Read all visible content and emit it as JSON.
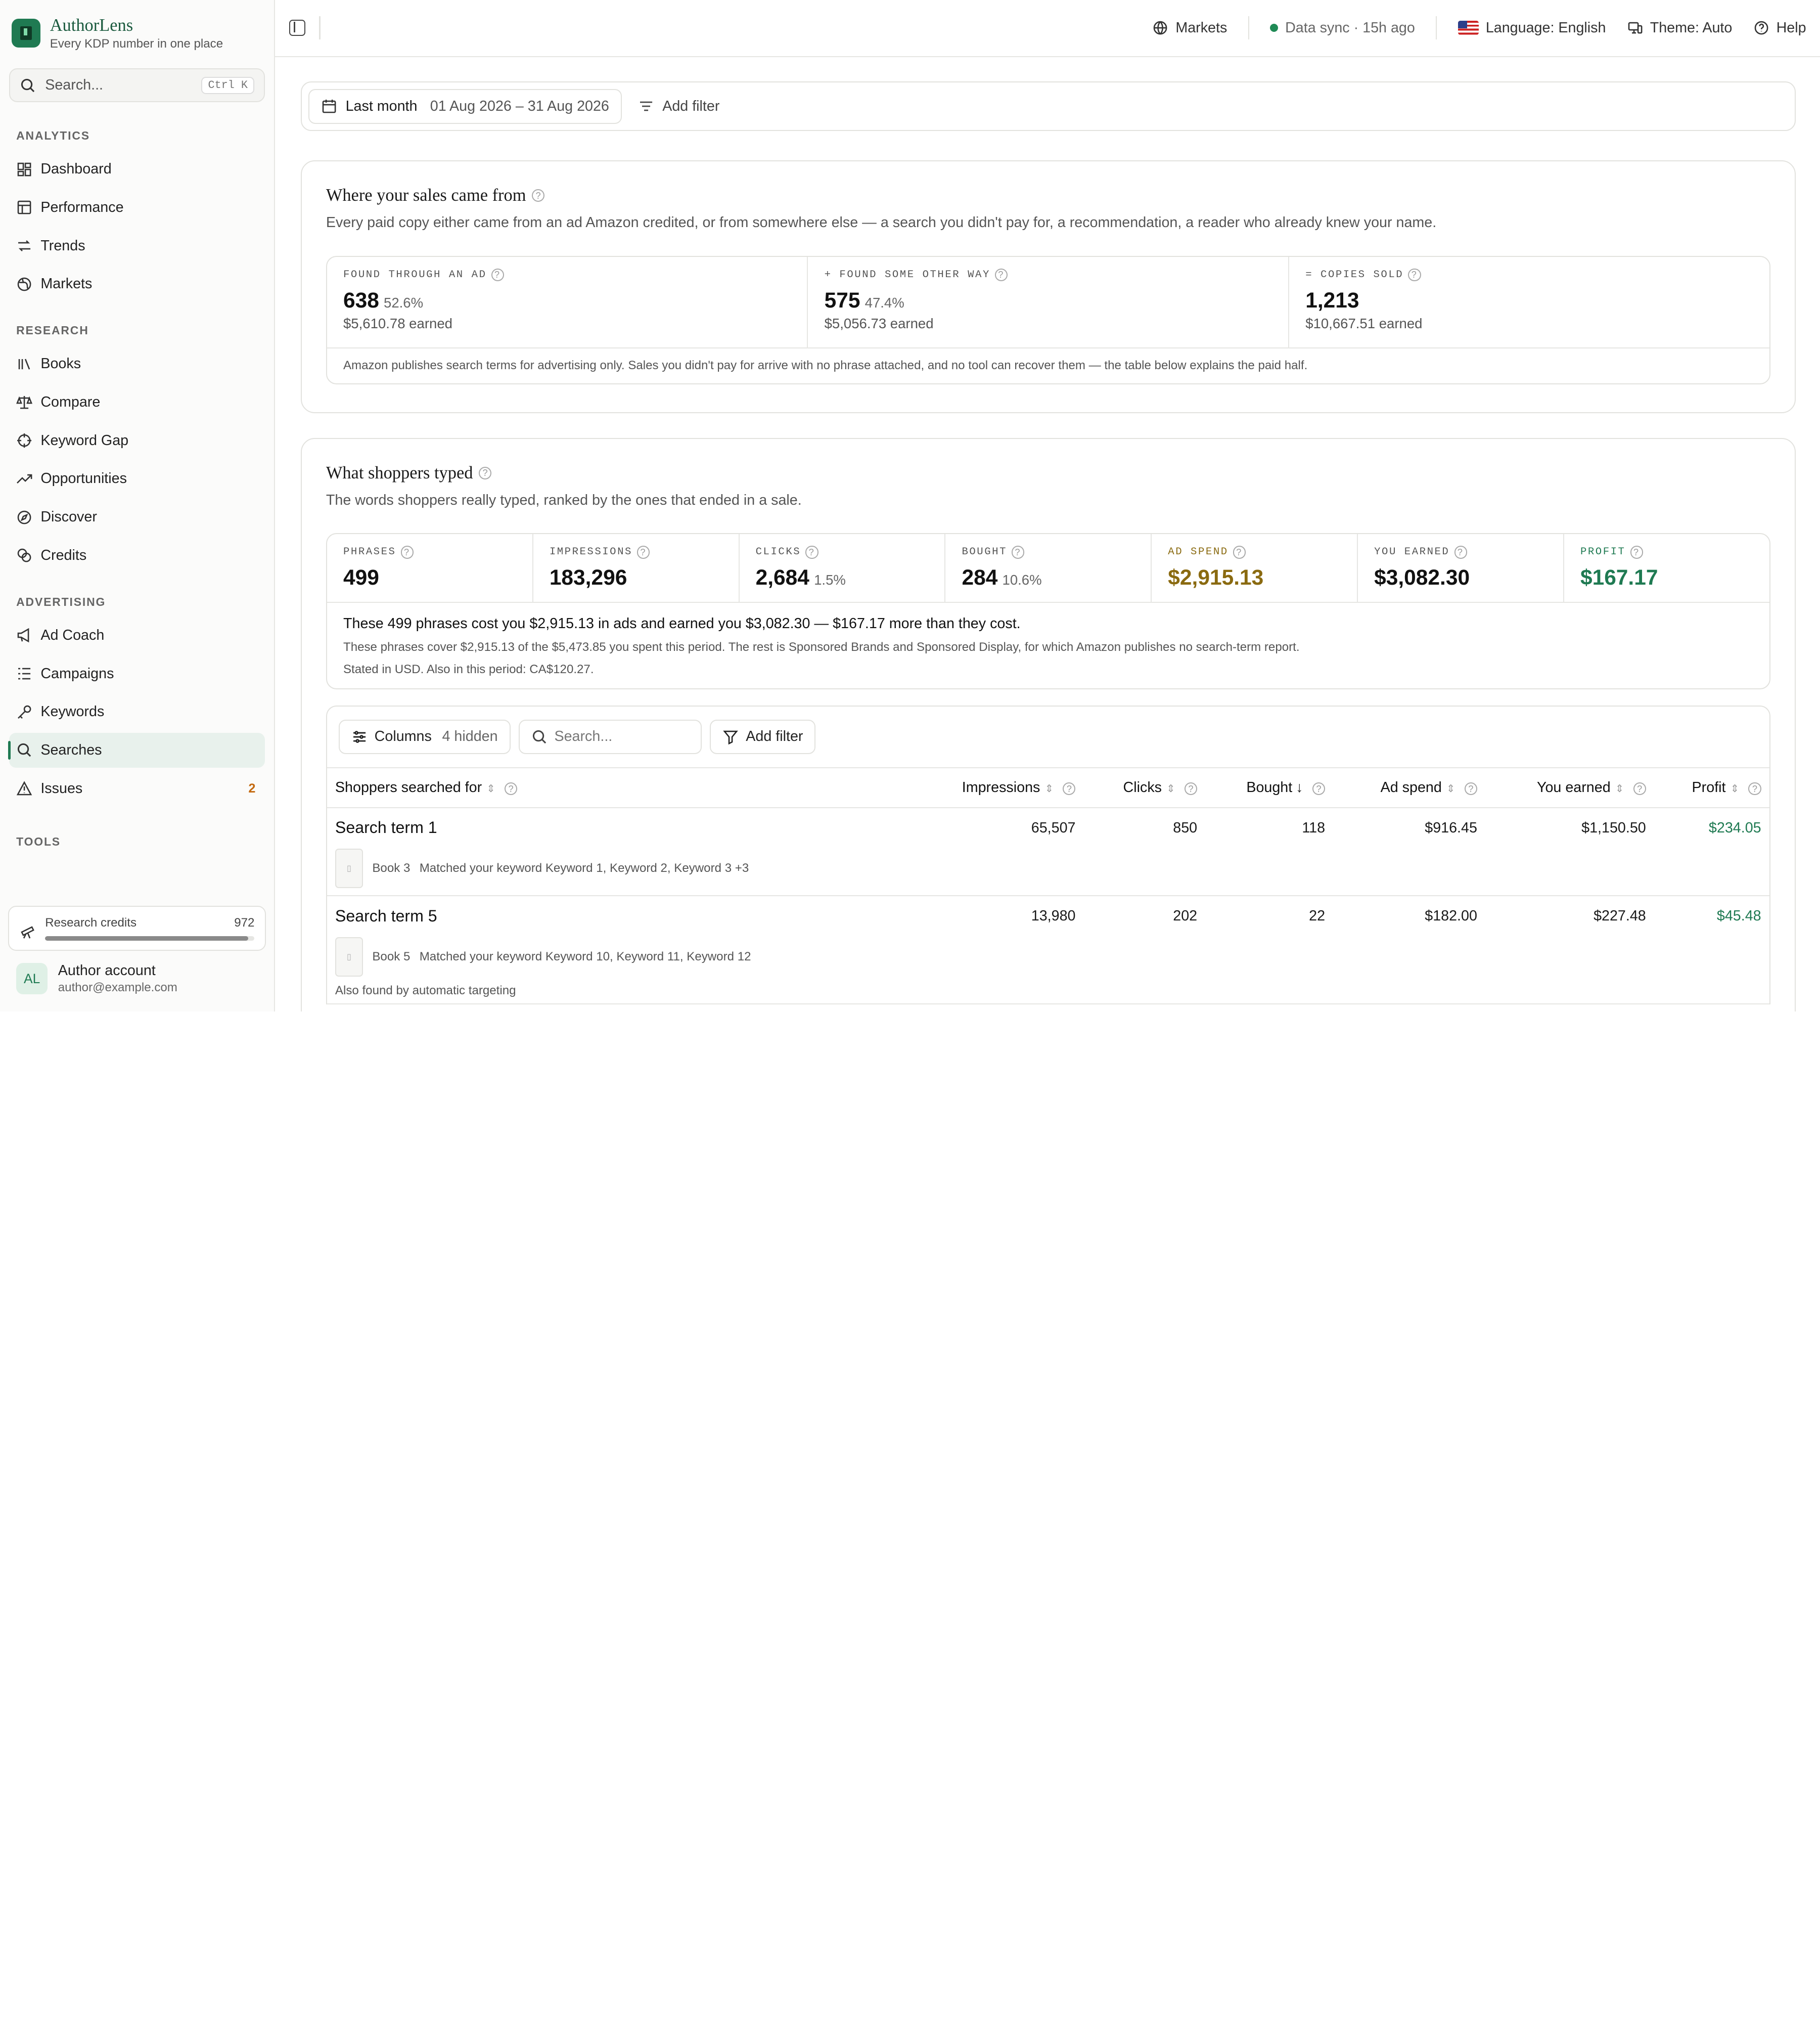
{
  "brand": {
    "name": "AuthorLens",
    "tagline": "Every KDP number in one place"
  },
  "search": {
    "placeholder": "Search...",
    "shortcut": "Ctrl K"
  },
  "nav": {
    "analytics_label": "ANALYTICS",
    "analytics": [
      {
        "label": "Dashboard",
        "icon": "dashboard-icon"
      },
      {
        "label": "Performance",
        "icon": "table-icon"
      },
      {
        "label": "Trends",
        "icon": "trends-icon"
      },
      {
        "label": "Markets",
        "icon": "globe-icon"
      }
    ],
    "research_label": "RESEARCH",
    "research": [
      {
        "label": "Books",
        "icon": "books-icon"
      },
      {
        "label": "Compare",
        "icon": "scale-icon"
      },
      {
        "label": "Keyword Gap",
        "icon": "crosshair-icon"
      },
      {
        "label": "Opportunities",
        "icon": "trending-up-icon"
      },
      {
        "label": "Discover",
        "icon": "compass-icon"
      },
      {
        "label": "Credits",
        "icon": "coins-icon"
      }
    ],
    "advertising_label": "ADVERTISING",
    "advertising": [
      {
        "label": "Ad Coach",
        "icon": "megaphone-icon"
      },
      {
        "label": "Campaigns",
        "icon": "list-icon"
      },
      {
        "label": "Keywords",
        "icon": "key-icon"
      },
      {
        "label": "Searches",
        "icon": "search-icon",
        "active": true
      },
      {
        "label": "Issues",
        "icon": "warning-icon",
        "badge": "2"
      }
    ],
    "tools_label": "TOOLS"
  },
  "credits": {
    "label": "Research credits",
    "value": "972",
    "level": 0.97
  },
  "account": {
    "initials": "AL",
    "name": "Author account",
    "email": "author@example.com"
  },
  "topbar": {
    "markets": "Markets",
    "sync": "Data sync · 15h ago",
    "language": "Language: English",
    "theme": "Theme: Auto",
    "help": "Help"
  },
  "filter": {
    "preset": "Last month",
    "range": "01 Aug 2026 – 31 Aug 2026",
    "add_filter": "Add filter"
  },
  "sales_card": {
    "title": "Where your sales came from",
    "subtitle": "Every paid copy either came from an ad Amazon credited, or from somewhere else — a search you didn't pay for, a recommendation, a reader who already knew your name.",
    "stats": [
      {
        "label": "FOUND THROUGH AN AD",
        "value": "638",
        "pct": "52.6%",
        "sub": "$5,610.78 earned"
      },
      {
        "label": "+ FOUND SOME OTHER WAY",
        "value": "575",
        "pct": "47.4%",
        "sub": "$5,056.73 earned"
      },
      {
        "label": "= COPIES SOLD",
        "value": "1,213",
        "pct": "",
        "sub": "$10,667.51 earned"
      }
    ],
    "note": "Amazon publishes search terms for advertising only. Sales you didn't pay for arrive with no phrase attached, and no tool can recover them — the table below explains the paid half."
  },
  "shoppers_card": {
    "title": "What shoppers typed",
    "subtitle": "The words shoppers really typed, ranked by the ones that ended in a sale.",
    "stats": [
      {
        "label": "PHRASES",
        "value": "499",
        "pct": ""
      },
      {
        "label": "IMPRESSIONS",
        "value": "183,296",
        "pct": ""
      },
      {
        "label": "CLICKS",
        "value": "2,684",
        "pct": "1.5%"
      },
      {
        "label": "BOUGHT",
        "value": "284",
        "pct": "10.6%"
      },
      {
        "label": "AD SPEND",
        "value": "$2,915.13",
        "pct": ""
      },
      {
        "label": "YOU EARNED",
        "value": "$3,082.30",
        "pct": ""
      },
      {
        "label": "PROFIT",
        "value": "$167.17",
        "pct": ""
      }
    ],
    "summary": "These 499 phrases cost you $2,915.13 in ads and earned you $3,082.30 — $167.17 more than they cost.",
    "detail": "These phrases cover $2,915.13 of the $5,473.85 you spent this period. The rest is Sponsored Brands and Sponsored Display, for which Amazon publishes no search-term report.",
    "currency_note": "Stated in USD. Also in this period: CA$120.27."
  },
  "table": {
    "columns_btn": "Columns",
    "hidden": "4 hidden",
    "search_placeholder": "Search...",
    "add_filter": "Add filter",
    "headers": {
      "term": "Shoppers searched for",
      "impressions": "Impressions",
      "clicks": "Clicks",
      "bought": "Bought",
      "spend": "Ad spend",
      "earned": "You earned",
      "profit": "Profit"
    },
    "rows": [
      {
        "term": "Search term 1",
        "impressions": "65,507",
        "clicks": "850",
        "bought": "118",
        "spend": "$916.45",
        "earned": "$1,150.50",
        "profit": "$234.05",
        "book": "Book 3",
        "match": "Matched your keyword Keyword 1, Keyword 2, Keyword 3 +3",
        "also": ""
      },
      {
        "term": "Search term 5",
        "impressions": "13,980",
        "clicks": "202",
        "bought": "22",
        "spend": "$182.00",
        "earned": "$227.48",
        "profit": "$45.48",
        "book": "Book 5",
        "match": "Matched your keyword Keyword 10, Keyword 11, Keyword 12",
        "also": "Also found by automatic targeting"
      }
    ]
  }
}
